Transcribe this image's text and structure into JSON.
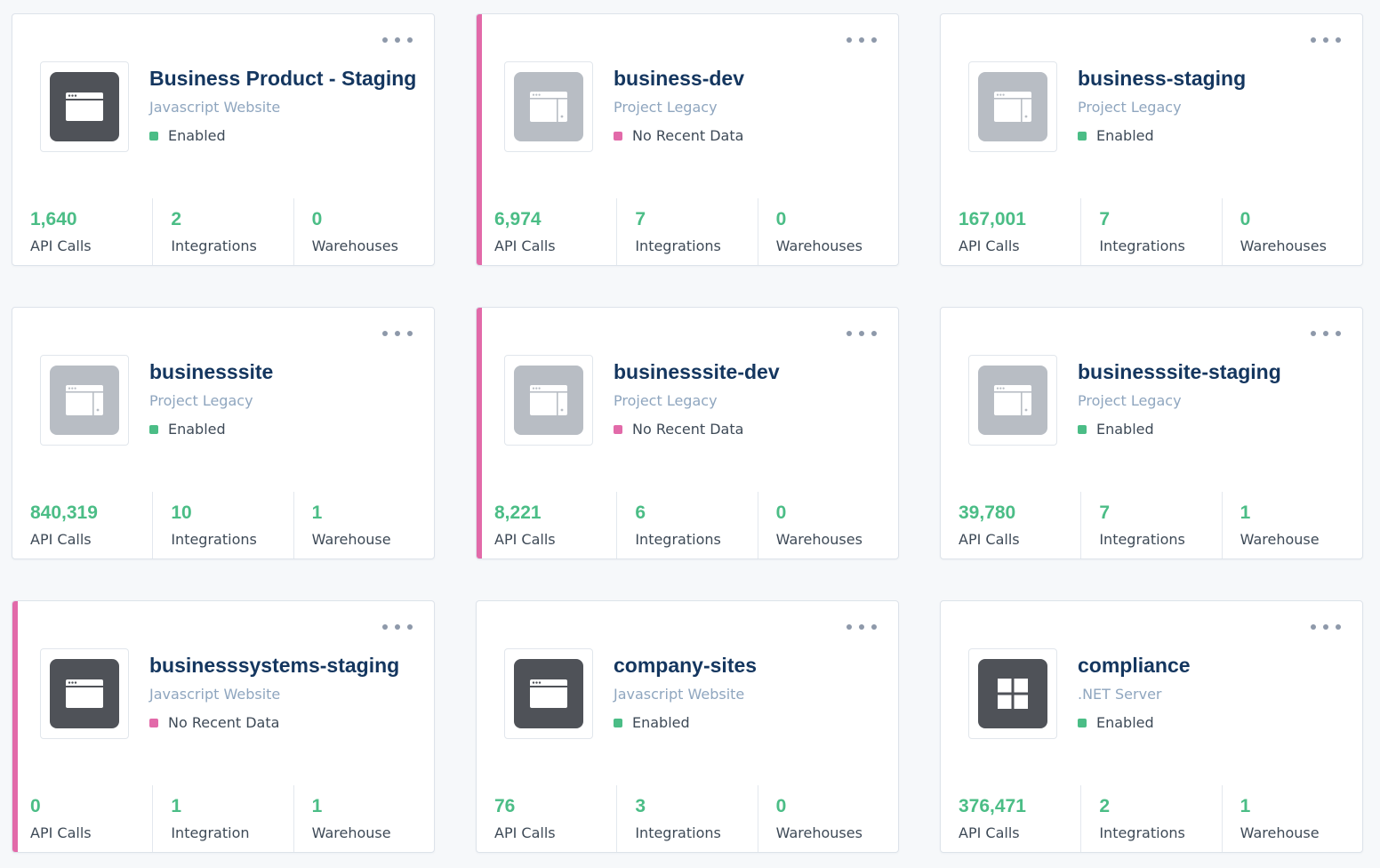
{
  "colors": {
    "title": "#14365f",
    "subtitle": "#8fa6bf",
    "metric": "#4bbd86",
    "enabled": "#4bbd86",
    "no_data": "#e26aa9",
    "warning_bar": "#e26aa9"
  },
  "sources": [
    {
      "name": "Business Product - Staging",
      "type": "Javascript Website",
      "status": "Enabled",
      "status_kind": "enabled",
      "icon": "browser-window-icon",
      "icon_style": "dark",
      "stats": [
        {
          "value": "1,640",
          "label": "API Calls"
        },
        {
          "value": "2",
          "label": "Integrations"
        },
        {
          "value": "0",
          "label": "Warehouses"
        }
      ]
    },
    {
      "name": "business-dev",
      "type": "Project Legacy",
      "status": "No Recent Data",
      "status_kind": "no-data",
      "icon": "legacy-project-icon",
      "icon_style": "light",
      "stats": [
        {
          "value": "6,974",
          "label": "API Calls"
        },
        {
          "value": "7",
          "label": "Integrations"
        },
        {
          "value": "0",
          "label": "Warehouses"
        }
      ]
    },
    {
      "name": "business-staging",
      "type": "Project Legacy",
      "status": "Enabled",
      "status_kind": "enabled",
      "icon": "legacy-project-icon",
      "icon_style": "light",
      "stats": [
        {
          "value": "167,001",
          "label": "API Calls"
        },
        {
          "value": "7",
          "label": "Integrations"
        },
        {
          "value": "0",
          "label": "Warehouses"
        }
      ]
    },
    {
      "name": "businesssite",
      "type": "Project Legacy",
      "status": "Enabled",
      "status_kind": "enabled",
      "icon": "legacy-project-icon",
      "icon_style": "light",
      "stats": [
        {
          "value": "840,319",
          "label": "API Calls"
        },
        {
          "value": "10",
          "label": "Integrations"
        },
        {
          "value": "1",
          "label": "Warehouse"
        }
      ]
    },
    {
      "name": "businesssite-dev",
      "type": "Project Legacy",
      "status": "No Recent Data",
      "status_kind": "no-data",
      "icon": "legacy-project-icon",
      "icon_style": "light",
      "stats": [
        {
          "value": "8,221",
          "label": "API Calls"
        },
        {
          "value": "6",
          "label": "Integrations"
        },
        {
          "value": "0",
          "label": "Warehouses"
        }
      ]
    },
    {
      "name": "businesssite-staging",
      "type": "Project Legacy",
      "status": "Enabled",
      "status_kind": "enabled",
      "icon": "legacy-project-icon",
      "icon_style": "light",
      "stats": [
        {
          "value": "39,780",
          "label": "API Calls"
        },
        {
          "value": "7",
          "label": "Integrations"
        },
        {
          "value": "1",
          "label": "Warehouse"
        }
      ]
    },
    {
      "name": "businesssystems-staging",
      "type": "Javascript Website",
      "status": "No Recent Data",
      "status_kind": "no-data",
      "icon": "browser-window-icon",
      "icon_style": "dark",
      "stats": [
        {
          "value": "0",
          "label": "API Calls"
        },
        {
          "value": "1",
          "label": "Integration"
        },
        {
          "value": "1",
          "label": "Warehouse"
        }
      ]
    },
    {
      "name": "company-sites",
      "type": "Javascript Website",
      "status": "Enabled",
      "status_kind": "enabled",
      "icon": "browser-window-icon",
      "icon_style": "dark",
      "stats": [
        {
          "value": "76",
          "label": "API Calls"
        },
        {
          "value": "3",
          "label": "Integrations"
        },
        {
          "value": "0",
          "label": "Warehouses"
        }
      ]
    },
    {
      "name": "compliance",
      "type": ".NET Server",
      "status": "Enabled",
      "status_kind": "enabled",
      "icon": "windows-logo-icon",
      "icon_style": "dark",
      "stats": [
        {
          "value": "376,471",
          "label": "API Calls"
        },
        {
          "value": "2",
          "label": "Integrations"
        },
        {
          "value": "1",
          "label": "Warehouse"
        }
      ]
    }
  ]
}
